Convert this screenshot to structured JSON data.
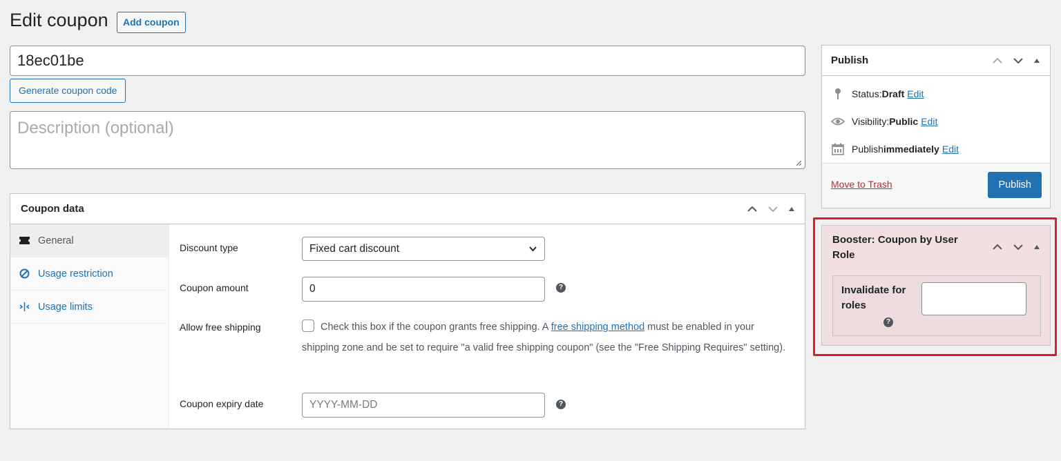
{
  "header": {
    "title": "Edit coupon",
    "add_button": "Add coupon"
  },
  "coupon": {
    "code": "18ec01be",
    "generate_button": "Generate coupon code",
    "description_placeholder": "Description (optional)"
  },
  "coupon_data": {
    "title": "Coupon data",
    "tabs": [
      {
        "label": "General",
        "icon": "ticket-icon"
      },
      {
        "label": "Usage restriction",
        "icon": "block-icon"
      },
      {
        "label": "Usage limits",
        "icon": "limits-icon"
      }
    ],
    "fields": {
      "discount_type_label": "Discount type",
      "discount_type_value": "Fixed cart discount",
      "amount_label": "Coupon amount",
      "amount_value": "0",
      "free_shipping_label": "Allow free shipping",
      "free_shipping_text_before": "Check this box if the coupon grants free shipping. A ",
      "free_shipping_link": "free shipping method",
      "free_shipping_text_after": " must be enabled in your shipping zone and be set to require \"a valid free shipping coupon\" (see the \"Free Shipping Requires\" setting).",
      "expiry_label": "Coupon expiry date",
      "expiry_placeholder": "YYYY-MM-DD",
      "help_glyph": "?"
    }
  },
  "publish": {
    "title": "Publish",
    "status_label": "Status: ",
    "status_value": "Draft",
    "visibility_label": "Visibility: ",
    "visibility_value": "Public",
    "publish_label": "Publish ",
    "publish_value": "immediately",
    "edit_link": "Edit",
    "trash_link": "Move to Trash",
    "publish_button": "Publish"
  },
  "booster": {
    "title": "Booster: Coupon by User Role",
    "invalidate_label": "Invalidate for roles",
    "help_glyph": "?"
  },
  "colors": {
    "accent": "#2271b1",
    "trash": "#b32d2e",
    "highlight_border": "#e01b24",
    "booster_bg": "#f2e0e0"
  }
}
